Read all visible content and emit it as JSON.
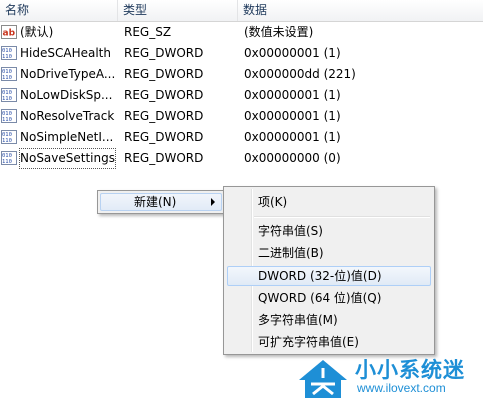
{
  "columns": {
    "name": "名称",
    "type": "类型",
    "data": "数据"
  },
  "rows": [
    {
      "icon": "string-value-icon",
      "name": "(默认)",
      "type": "REG_SZ",
      "data": "(数值未设置)"
    },
    {
      "icon": "dword-value-icon",
      "name": "HideSCAHealth",
      "type": "REG_DWORD",
      "data": "0x00000001 (1)"
    },
    {
      "icon": "dword-value-icon",
      "name": "NoDriveTypeA...",
      "type": "REG_DWORD",
      "data": "0x000000dd (221)"
    },
    {
      "icon": "dword-value-icon",
      "name": "NoLowDiskSp...",
      "type": "REG_DWORD",
      "data": "0x00000001 (1)"
    },
    {
      "icon": "dword-value-icon",
      "name": "NoResolveTrack",
      "type": "REG_DWORD",
      "data": "0x00000001 (1)"
    },
    {
      "icon": "dword-value-icon",
      "name": "NoSimpleNetI...",
      "type": "REG_DWORD",
      "data": "0x00000001 (1)"
    },
    {
      "icon": "dword-value-icon",
      "name": "NoSaveSettings",
      "type": "REG_DWORD",
      "data": "0x00000000 (0)"
    }
  ],
  "context_menu": {
    "new_label": "新建(N)"
  },
  "submenu": {
    "key": "项(K)",
    "string": "字符串值(S)",
    "binary": "二进制值(B)",
    "dword": "DWORD (32-位)值(D)",
    "qword": "QWORD (64 位)值(Q)",
    "multi_string": "多字符串值(M)",
    "expandable_string": "可扩充字符串值(E)"
  },
  "watermark": {
    "title": "小小系统迷",
    "url": "www.ilovext.com"
  },
  "colors": {
    "accent": "#1e8fd6",
    "menu_bg": "#f0f0f0",
    "hover_border": "#aecff7"
  }
}
